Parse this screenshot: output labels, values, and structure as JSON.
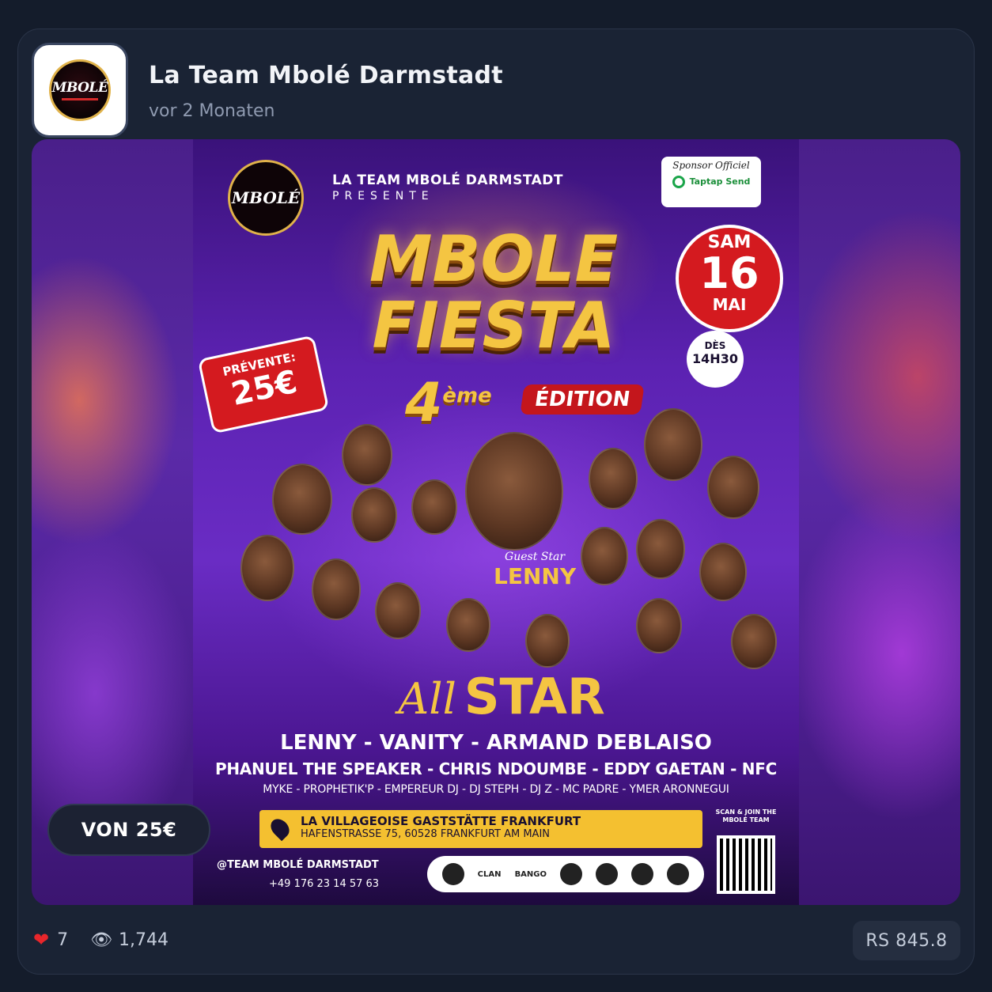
{
  "post": {
    "account_name": "La Team Mbolé Darmstadt",
    "timestamp": "vor 2 Monaten",
    "avatar_logo_text": "MBOLÉ",
    "price_label": "VON 25€",
    "likes": "7",
    "views": "1,744",
    "value": "RS 845.8"
  },
  "poster": {
    "logo_text": "MBOLÉ",
    "org": "LA TEAM MBOLÉ DARMSTADT",
    "presente": "PRESENTE",
    "sponsor_label": "Sponsor Officiel",
    "sponsor_name": "Taptap Send",
    "title_line1": "MBOLE",
    "title_line2": "FIESTA",
    "edition_number": "4",
    "edition_suffix": "ème",
    "edition_word": "ÉDITION",
    "date_day": "SAM",
    "date_num": "16",
    "date_month": "MAI",
    "time_prefix": "DÈS",
    "time": "14H30",
    "presale_label": "PRÉVENTE:",
    "presale_price": "25€",
    "guest_label": "Guest Star",
    "guest_name": "LENNY",
    "allstar_script": "All",
    "allstar_word": "STAR",
    "lineup_line1": "LENNY - VANITY - ARMAND DEBLAISO",
    "lineup_line2": "PHANUEL THE SPEAKER - CHRIS NDOUMBE - EDDY GAETAN - NFC",
    "lineup_line3": "MYKE - PROPHETIK'P - EMPEREUR DJ - DJ STEPH - DJ Z - MC PADRE - YMER ARONNEGUI",
    "venue_name": "LA VILLAGEOISE GASTSTÄTTE FRANKFURT",
    "venue_address": "HAFENSTRASSE 75, 60528 FRANKFURT AM MAIN",
    "scan_text": "SCAN & JOIN THE MBOLÉ TEAM",
    "social_handle": "@TEAM MBOLÉ DARMSTADT",
    "phone": "+49 176 23 14 57 63",
    "sponsor_clan": "CLAN",
    "sponsor_bango": "BANGO"
  },
  "icons": {
    "heart": "heart-icon",
    "eye": "eye-icon",
    "location": "location-pin-icon",
    "qr": "qr-code-icon"
  },
  "colors": {
    "page_bg": "#141c2b",
    "card_bg": "#1a2334",
    "poster_gold": "#f4c542",
    "poster_red": "#d41a1f",
    "heart": "#e8262b"
  }
}
